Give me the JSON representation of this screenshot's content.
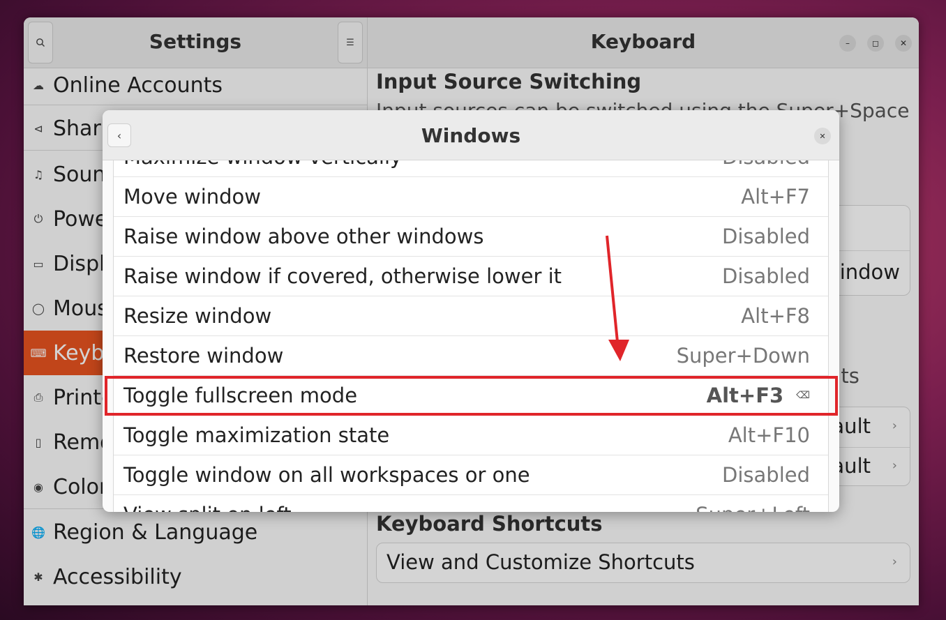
{
  "settings": {
    "title": "Settings",
    "sidebar": [
      {
        "label": "Online Accounts",
        "icon": "cloud-icon"
      },
      {
        "label": "Sharing",
        "icon": "share-icon"
      },
      {
        "label": "Sound",
        "icon": "music-note-icon"
      },
      {
        "label": "Power",
        "icon": "power-icon"
      },
      {
        "label": "Displays",
        "icon": "display-icon"
      },
      {
        "label": "Mouse & Touchpad",
        "icon": "mouse-icon"
      },
      {
        "label": "Keyboard",
        "icon": "keyboard-icon",
        "active": true
      },
      {
        "label": "Printers",
        "icon": "printer-icon"
      },
      {
        "label": "Removable Media",
        "icon": "usb-drive-icon"
      },
      {
        "label": "Color",
        "icon": "color-icon"
      },
      {
        "label": "Region & Language",
        "icon": "globe-icon"
      },
      {
        "label": "Accessibility",
        "icon": "accessibility-icon"
      }
    ]
  },
  "keyboard": {
    "title": "Keyboard",
    "input_source_switching_title": "Input Source Switching",
    "input_source_desc": "Input sources can be switched using the Super+Space",
    "window_fragment": "indow",
    "shortcuts_fragment": "nts",
    "default1_fragment": "fault",
    "default2_fragment": "fault",
    "keyboard_shortcuts_title": "Keyboard Shortcuts",
    "view_customize_label": "View and Customize Shortcuts"
  },
  "dialog": {
    "title": "Windows",
    "top_partial": {
      "label": "Maximize window vertically",
      "accel": "Disabled"
    },
    "rows": [
      {
        "label": "Move window",
        "accel": "Alt+F7"
      },
      {
        "label": "Raise window above other windows",
        "accel": "Disabled"
      },
      {
        "label": "Raise window if covered, otherwise lower it",
        "accel": "Disabled"
      },
      {
        "label": "Resize window",
        "accel": "Alt+F8"
      },
      {
        "label": "Restore window",
        "accel": "Super+Down"
      },
      {
        "label": "Toggle fullscreen mode",
        "accel": "Alt+F3",
        "custom": true
      },
      {
        "label": "Toggle maximization state",
        "accel": "Alt+F10"
      },
      {
        "label": "Toggle window on all workspaces or one",
        "accel": "Disabled"
      }
    ],
    "bottom_partial": {
      "label": "View split on left",
      "accel": "Super+Left"
    }
  },
  "annotation": {
    "color": "#e0252a"
  }
}
